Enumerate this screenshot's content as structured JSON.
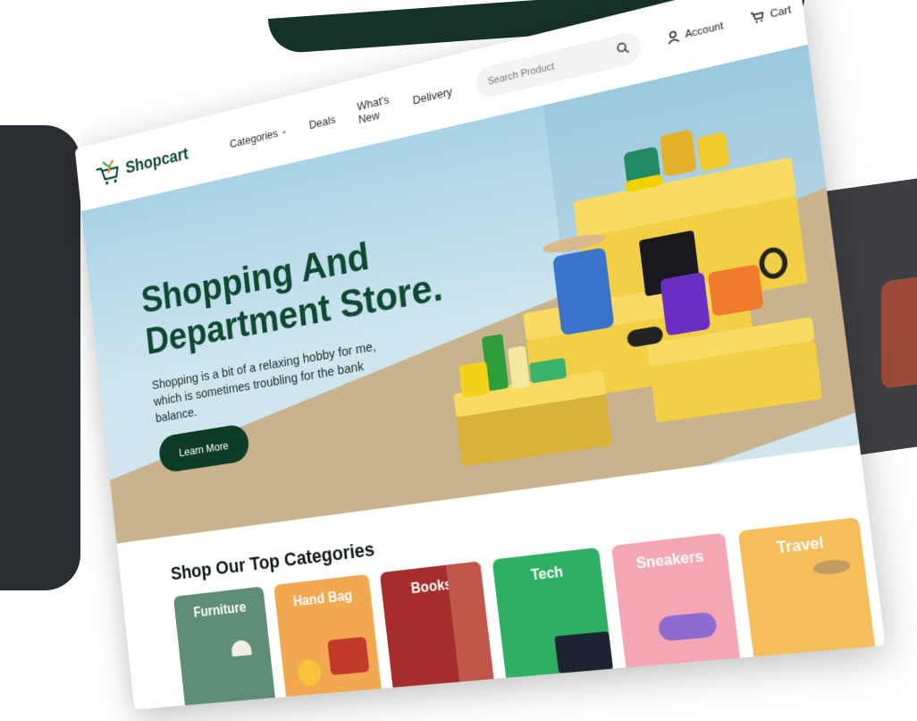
{
  "brand": {
    "name": "Shopcart"
  },
  "nav": {
    "items": [
      {
        "label": "Categories",
        "has_dropdown": true
      },
      {
        "label": "Deals"
      },
      {
        "label": "What's New"
      },
      {
        "label": "Delivery"
      }
    ]
  },
  "search": {
    "placeholder": "Search Product"
  },
  "utility": {
    "account_label": "Account",
    "cart_label": "Cart"
  },
  "hero": {
    "title": "Shopping And Department Store.",
    "subtitle": "Shopping is a bit of a relaxing hobby for me, which is sometimes troubling for the bank balance.",
    "cta_label": "Learn More"
  },
  "categories": {
    "heading": "Shop Our Top Categories",
    "items": [
      {
        "label": "Furniture",
        "color": "#5f8e76"
      },
      {
        "label": "Hand Bag",
        "color": "#f2a850"
      },
      {
        "label": "Books",
        "color": "#a62d2d"
      },
      {
        "label": "Tech",
        "color": "#2faf63"
      },
      {
        "label": "Sneakers",
        "color": "#f4a6b3"
      },
      {
        "label": "Travel",
        "color": "#f6bd5b"
      }
    ]
  },
  "colors": {
    "brand_green": "#0e4a31",
    "cta_dark_green": "#0e3d27",
    "podium_yellow": "#f3cf46",
    "sky": "#a9d3e6",
    "floor": "#c9b38c"
  }
}
